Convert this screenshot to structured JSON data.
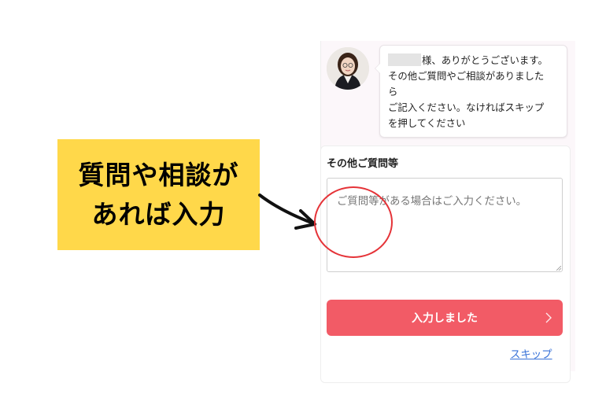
{
  "callout": {
    "line1": "質問や相談が",
    "line2": "あれば入力"
  },
  "chat": {
    "avatar": "operator-avatar",
    "message_lines": [
      "様、ありがとうございます。",
      "その他ご質問やご相談がありました",
      "ら",
      "ご記入ください。なければスキップ",
      "を押してください"
    ]
  },
  "form": {
    "label": "その他ご質問等",
    "placeholder": "ご質問等がある場合はご入力ください。",
    "submit_label": "入力しました",
    "skip_label": "スキップ"
  },
  "colors": {
    "callout_bg": "#ffd84a",
    "submit_bg": "#f25b66",
    "highlight_circle": "#e53338",
    "skip_link": "#3a73d8"
  }
}
